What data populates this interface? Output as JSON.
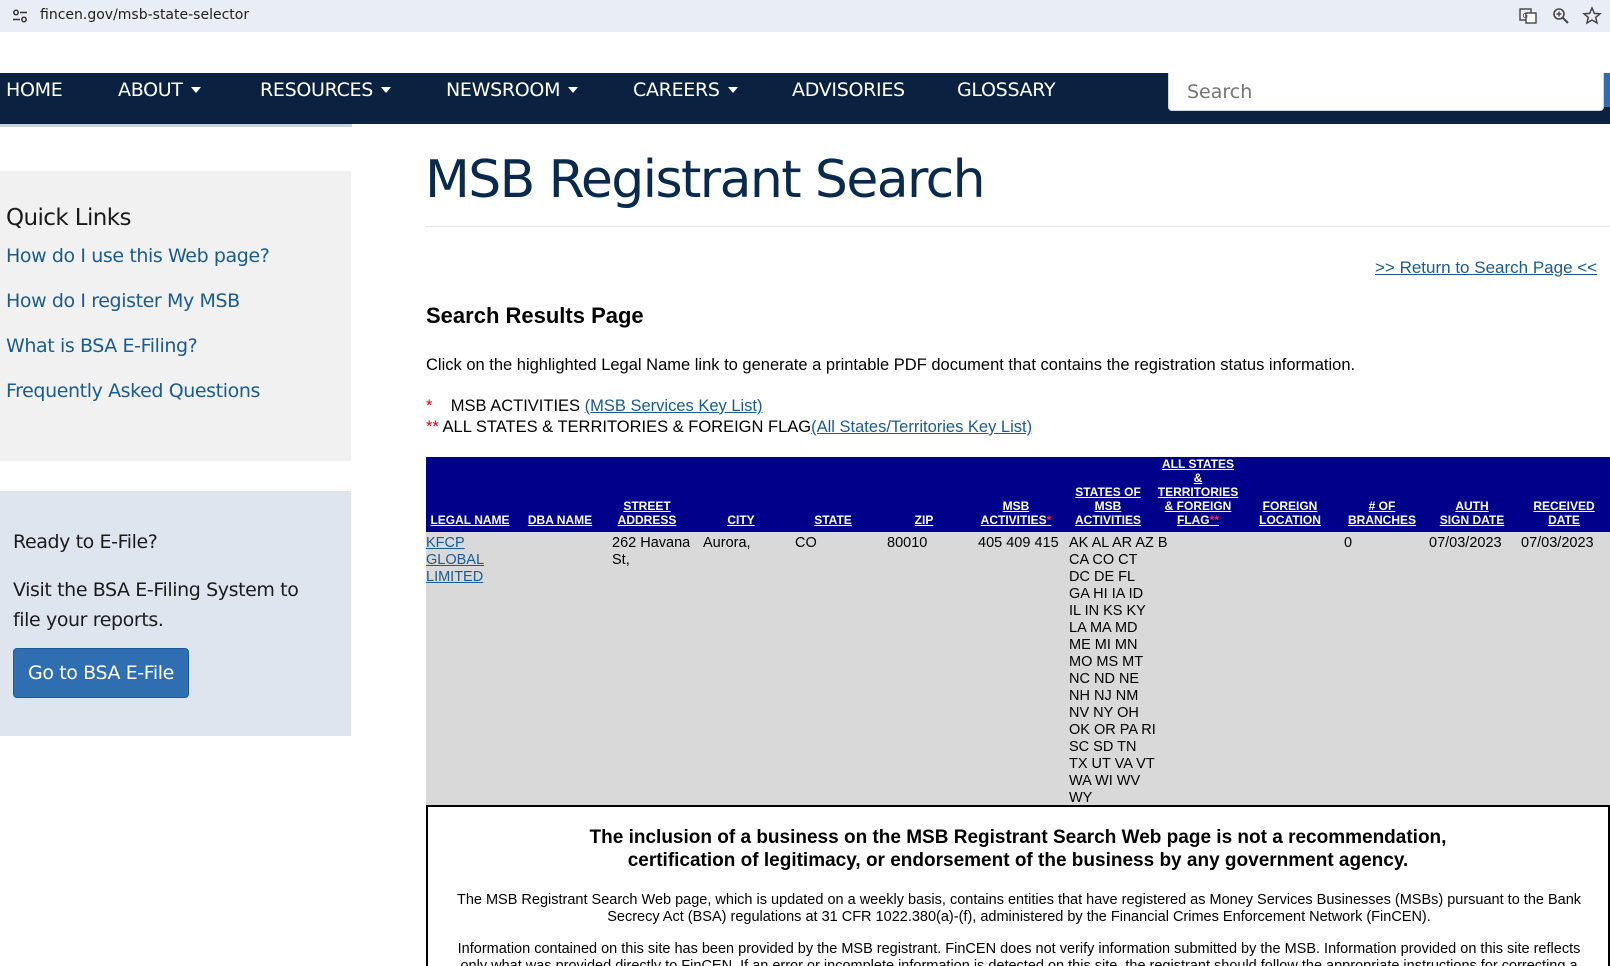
{
  "browser": {
    "url": "fincen.gov/msb-state-selector"
  },
  "nav": {
    "items": [
      {
        "label": "HOME",
        "dropdown": false
      },
      {
        "label": "ABOUT",
        "dropdown": true
      },
      {
        "label": "RESOURCES",
        "dropdown": true
      },
      {
        "label": "NEWSROOM",
        "dropdown": true
      },
      {
        "label": "CAREERS",
        "dropdown": true
      },
      {
        "label": "ADVISORIES",
        "dropdown": false
      },
      {
        "label": "GLOSSARY",
        "dropdown": false
      }
    ],
    "search_placeholder": "Search"
  },
  "sidebar": {
    "quick_links_title": "Quick Links",
    "quick_links": [
      "How do I use this Web page?",
      "How do I register My MSB",
      "What is BSA E-Filing?",
      "Frequently Asked Questions"
    ],
    "efile": {
      "title": "Ready to E-File?",
      "text": "Visit the BSA E-Filing System to file your reports.",
      "button": "Go to BSA E-File"
    }
  },
  "main": {
    "title": "MSB Registrant Search",
    "return_link": ">> Return to Search Page <<",
    "results_heading": "Search Results Page",
    "instructions": "Click on the highlighted Legal Name link to generate a printable PDF document that contains the registration status information.",
    "legend": {
      "star1": "*",
      "activities_label": "MSB ACTIVITIES",
      "activities_link": "(MSB Services Key List)",
      "star2": "**",
      "states_label": "ALL STATES & TERRITORIES & FOREIGN FLAG",
      "states_link": "(All States/Territories Key List)"
    }
  },
  "table": {
    "headers": {
      "legal_name": "LEGAL NAME",
      "dba_name": "DBA NAME",
      "street_1": "STREET",
      "street_2": "ADDRESS",
      "city": "CITY",
      "state": "STATE",
      "zip": "ZIP",
      "msb_1": "MSB",
      "msb_2": "ACTIVITIES",
      "msb_star": "*",
      "states_1": "STATES OF",
      "states_2": "MSB",
      "states_3": "ACTIVITIES",
      "all_1": "ALL STATES",
      "all_2": "&",
      "all_3": "TERRITORIES",
      "all_4": "& FOREIGN",
      "all_5": "FLAG",
      "all_star": "**",
      "foreign_1": "FOREIGN",
      "foreign_2": "LOCATION",
      "branches_1": "# OF",
      "branches_2": "BRANCHES",
      "auth_1": "AUTH",
      "auth_2": "SIGN DATE",
      "received_1": "RECEIVED",
      "received_2": "DATE"
    },
    "row": {
      "legal_name": [
        "KFCP",
        "GLOBAL",
        "LIMITED"
      ],
      "dba_name": "",
      "street": [
        "262 Havana",
        "St,"
      ],
      "city": "Aurora,",
      "state": "CO",
      "zip": "80010",
      "msb_activities": "405 409 415",
      "states": [
        "AK AL AR AZ B",
        "CA CO CT",
        "DC DE FL",
        "GA HI IA ID",
        "IL IN KS KY",
        "LA MA MD",
        "ME MI MN",
        "MO MS MT",
        "NC ND NE",
        "NH NJ NM",
        "NV NY OH",
        "OK OR PA RI",
        "SC SD TN",
        "TX UT VA VT",
        "WA WI WV",
        "WY"
      ],
      "all_states_flag": "",
      "foreign_location": "",
      "branches": "0",
      "auth_sign_date": "07/03/2023",
      "received_date": "07/03/2023"
    }
  },
  "disclaimer": {
    "heading_1": "The inclusion of a business on the MSB Registrant Search Web page is not a recommendation,",
    "heading_2": "certification of legitimacy, or endorsement of the business by any government agency.",
    "para1_1": "The MSB Registrant Search Web page, which is updated on a weekly basis, contains entities that have registered as Money Services Businesses (MSBs) pursuant to the Bank",
    "para1_2": "Secrecy Act (BSA) regulations at 31 CFR 1022.380(a)-(f), administered by the Financial Crimes Enforcement Network (FinCEN).",
    "para2_1": "Information contained on this site has been provided by the MSB registrant. FinCEN does not verify information submitted by the MSB. Information provided on this site reflects",
    "para2_2": "only what was provided directly to FinCEN. If an error or incomplete information is detected on this site, the registrant should follow the appropriate instructions for correcting a"
  }
}
